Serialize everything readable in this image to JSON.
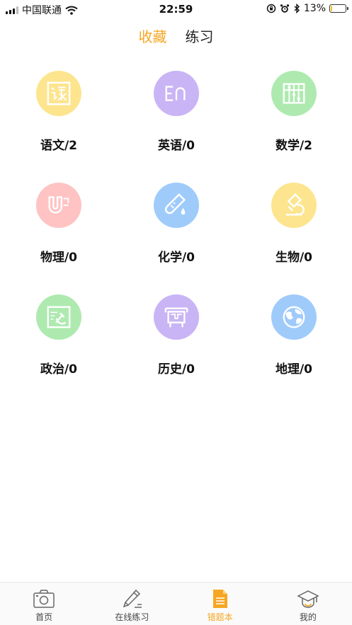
{
  "status_bar": {
    "carrier": "中国联通",
    "time": "22:59",
    "battery": "13%",
    "battery_level": 0.13
  },
  "top_tabs": [
    {
      "label": "收藏",
      "active": true
    },
    {
      "label": "练习",
      "active": false
    }
  ],
  "subjects": [
    {
      "name": "语文/2",
      "icon": "chinese-icon",
      "color": "#fde58f"
    },
    {
      "name": "英语/0",
      "icon": "english-icon",
      "color": "#c9b4f5"
    },
    {
      "name": "数学/2",
      "icon": "abacus-icon",
      "color": "#aeeab0"
    },
    {
      "name": "物理/0",
      "icon": "magnet-icon",
      "color": "#ffc3c3"
    },
    {
      "name": "化学/0",
      "icon": "test-tube-icon",
      "color": "#9fcbfb"
    },
    {
      "name": "生物/0",
      "icon": "microscope-icon",
      "color": "#fde58f"
    },
    {
      "name": "政治/0",
      "icon": "hammer-sickle-icon",
      "color": "#aeeab0"
    },
    {
      "name": "历史/0",
      "icon": "history-frame-icon",
      "color": "#c9b4f5"
    },
    {
      "name": "地理/0",
      "icon": "globe-icon",
      "color": "#9fcbfb"
    }
  ],
  "bottom_nav": [
    {
      "label": "首页",
      "icon": "camera-icon",
      "active": false
    },
    {
      "label": "在线练习",
      "icon": "pencil-icon",
      "active": false
    },
    {
      "label": "错题本",
      "icon": "notebook-icon",
      "active": true
    },
    {
      "label": "我的",
      "icon": "graduation-cap-icon",
      "active": false
    }
  ],
  "colors": {
    "accent": "#f6a623"
  }
}
